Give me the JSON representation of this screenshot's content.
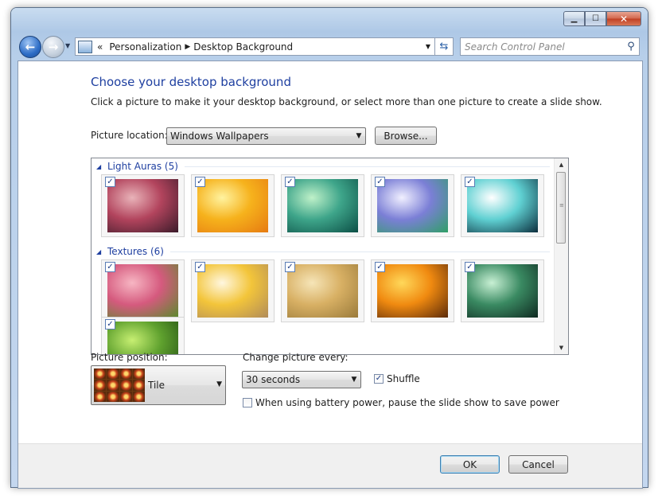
{
  "titlebar": {
    "controls": [
      "minimize-icon",
      "maximize-icon",
      "close-icon"
    ]
  },
  "nav": {
    "back_icon": "back-arrow-icon",
    "forward_icon": "forward-arrow-icon",
    "crumbs": [
      "Personalization",
      "Desktop Background"
    ],
    "overflow": "«",
    "search_placeholder": "Search Control Panel"
  },
  "page": {
    "title": "Choose your desktop background",
    "description": "Click a picture to make it your desktop background, or select more than one picture to create a slide show.",
    "picture_location_label": "Picture location:",
    "picture_location_value": "Windows Wallpapers",
    "browse_label": "Browse..."
  },
  "gallery": {
    "groups": [
      {
        "title": "Light Auras (5)",
        "items": [
          {
            "checked": true,
            "palette": [
              "#e9b3b9",
              "#b2445d",
              "#3b1b2a"
            ]
          },
          {
            "checked": true,
            "palette": [
              "#fff3a0",
              "#f6b21c",
              "#e67a11"
            ]
          },
          {
            "checked": true,
            "palette": [
              "#bff1c9",
              "#3ea58a",
              "#0b4e45"
            ]
          },
          {
            "checked": true,
            "palette": [
              "#f1f0ff",
              "#7b7fd6",
              "#2f9f66"
            ]
          },
          {
            "checked": true,
            "palette": [
              "#ffffff",
              "#5fd0d2",
              "#0b2d3c"
            ]
          }
        ]
      },
      {
        "title": "Textures (6)",
        "items": [
          {
            "checked": true,
            "palette": [
              "#f7b6c3",
              "#d55a7e",
              "#5a8a2c"
            ]
          },
          {
            "checked": true,
            "palette": [
              "#fff7e0",
              "#f3c53a",
              "#b08b5a"
            ]
          },
          {
            "checked": true,
            "palette": [
              "#f6e5b8",
              "#d8b064",
              "#9a7a3a"
            ]
          },
          {
            "checked": true,
            "palette": [
              "#ffd85a",
              "#f08a10",
              "#5b2a0a"
            ]
          },
          {
            "checked": true,
            "palette": [
              "#c8f0d4",
              "#3a8a62",
              "#0e2920"
            ]
          },
          {
            "checked": true,
            "palette": [
              "#c7ef72",
              "#5fa12e",
              "#1f4a12"
            ]
          }
        ]
      }
    ]
  },
  "options": {
    "position_label": "Picture position:",
    "position_value": "Tile",
    "change_label": "Change picture every:",
    "interval_value": "30 seconds",
    "shuffle_label": "Shuffle",
    "shuffle_checked": true,
    "battery_label": "When using battery power, pause the slide show to save power",
    "battery_checked": false
  },
  "footer": {
    "ok_label": "OK",
    "cancel_label": "Cancel"
  }
}
